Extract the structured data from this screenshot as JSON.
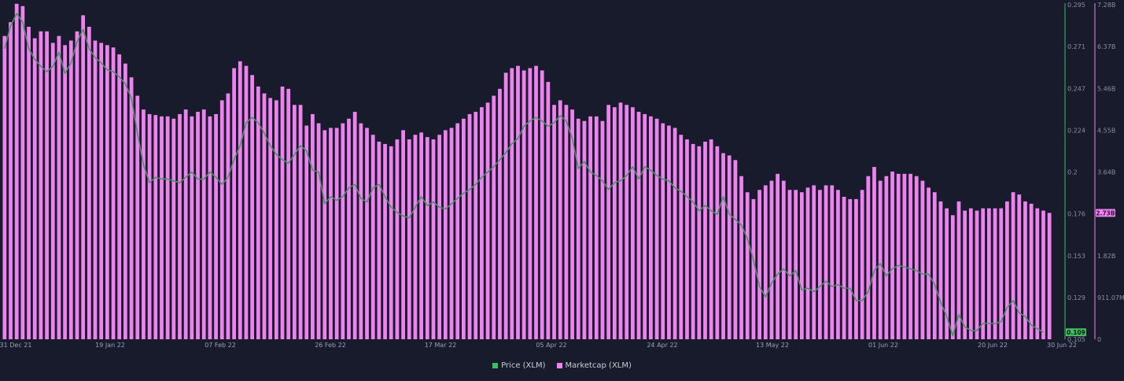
{
  "colors": {
    "background": "#171b2b",
    "price": "#3fbe5f",
    "marketcap": "#ee82ee",
    "price_line": "#4f8f6a"
  },
  "legend": {
    "price_label": "Price (XLM)",
    "marketcap_label": "Marketcap (XLM)"
  },
  "price_axis": {
    "ticks": [
      "0.295",
      "0.271",
      "0.247",
      "0.224",
      "0.2",
      "0.176",
      "0.153",
      "0.129",
      "0.105"
    ],
    "current_label": "0.109"
  },
  "marketcap_axis": {
    "ticks": [
      "7.28B",
      "6.37B",
      "5.46B",
      "4.55B",
      "3.64B",
      "2.73B",
      "1.82B",
      "911.07M",
      "0"
    ],
    "current_label": "2.73B"
  },
  "chart_data": {
    "type": "bar",
    "x_range": [
      "31 Dec 21",
      "30 Jun 22"
    ],
    "x_ticks": [
      "31 Dec 21",
      "19 Jan 22",
      "07 Feb 22",
      "26 Feb 22",
      "17 Mar 22",
      "05 Apr 22",
      "24 Apr 22",
      "13 May 22",
      "01 Jun 22",
      "20 Jun 22",
      "30 Jun 22"
    ],
    "price_ylim": [
      0.105,
      0.295
    ],
    "marketcap_ylim": [
      0,
      7280000000
    ],
    "grid": false,
    "legend_position": "bottom-center",
    "series": [
      {
        "name": "Marketcap (XLM)",
        "type": "bar",
        "values": [
          6.6,
          6.9,
          7.3,
          7.25,
          6.8,
          6.55,
          6.7,
          6.7,
          6.45,
          6.6,
          6.4,
          6.5,
          6.7,
          7.05,
          6.8,
          6.5,
          6.45,
          6.4,
          6.35,
          6.2,
          6.0,
          5.7,
          5.3,
          5.0,
          4.9,
          4.88,
          4.85,
          4.85,
          4.8,
          4.9,
          5.0,
          4.85,
          4.95,
          5.0,
          4.85,
          4.9,
          5.2,
          5.35,
          5.9,
          6.05,
          5.95,
          5.75,
          5.5,
          5.35,
          5.25,
          5.2,
          5.5,
          5.45,
          5.1,
          5.1,
          4.65,
          4.9,
          4.7,
          4.55,
          4.6,
          4.6,
          4.7,
          4.8,
          4.95,
          4.7,
          4.6,
          4.45,
          4.3,
          4.25,
          4.2,
          4.35,
          4.55,
          4.35,
          4.45,
          4.5,
          4.4,
          4.35,
          4.45,
          4.55,
          4.6,
          4.7,
          4.8,
          4.9,
          4.95,
          5.05,
          5.15,
          5.3,
          5.45,
          5.8,
          5.9,
          5.95,
          5.85,
          5.9,
          5.95,
          5.85,
          5.6,
          5.1,
          5.2,
          5.1,
          5.0,
          4.8,
          4.75,
          4.85,
          4.85,
          4.75,
          5.1,
          5.05,
          5.15,
          5.1,
          5.05,
          4.95,
          4.9,
          4.85,
          4.8,
          4.7,
          4.65,
          4.6,
          4.45,
          4.35,
          4.25,
          4.2,
          4.3,
          4.35,
          4.2,
          4.05,
          4.0,
          3.9,
          3.55,
          3.2,
          3.05,
          3.25,
          3.35,
          3.45,
          3.6,
          3.45,
          3.25,
          3.25,
          3.2,
          3.3,
          3.35,
          3.25,
          3.35,
          3.35,
          3.25,
          3.1,
          3.05,
          3.05,
          3.25,
          3.55,
          3.75,
          3.45,
          3.55,
          3.65,
          3.6,
          3.6,
          3.6,
          3.55,
          3.45,
          3.3,
          3.2,
          3.0,
          2.85,
          2.7,
          3.0,
          2.8,
          2.85,
          2.8,
          2.85,
          2.85,
          2.85,
          2.85,
          3.0,
          3.2,
          3.15,
          3.0,
          2.95,
          2.85,
          2.8,
          2.75
        ]
      },
      {
        "name": "Price (XLM)",
        "type": "line",
        "values": [
          0.27,
          0.283,
          0.29,
          0.285,
          0.27,
          0.264,
          0.26,
          0.257,
          0.26,
          0.268,
          0.256,
          0.262,
          0.274,
          0.281,
          0.27,
          0.265,
          0.262,
          0.258,
          0.257,
          0.254,
          0.25,
          0.242,
          0.222,
          0.204,
          0.194,
          0.197,
          0.196,
          0.196,
          0.195,
          0.194,
          0.197,
          0.2,
          0.196,
          0.196,
          0.2,
          0.197,
          0.193,
          0.197,
          0.207,
          0.215,
          0.228,
          0.231,
          0.228,
          0.222,
          0.215,
          0.21,
          0.207,
          0.205,
          0.21,
          0.215,
          0.212,
          0.201,
          0.2,
          0.182,
          0.186,
          0.184,
          0.186,
          0.191,
          0.193,
          0.185,
          0.183,
          0.191,
          0.193,
          0.186,
          0.18,
          0.177,
          0.175,
          0.174,
          0.18,
          0.186,
          0.181,
          0.183,
          0.18,
          0.179,
          0.182,
          0.185,
          0.188,
          0.19,
          0.193,
          0.197,
          0.2,
          0.203,
          0.207,
          0.211,
          0.216,
          0.219,
          0.226,
          0.229,
          0.231,
          0.229,
          0.226,
          0.228,
          0.232,
          0.229,
          0.219,
          0.202,
          0.206,
          0.2,
          0.198,
          0.195,
          0.19,
          0.194,
          0.195,
          0.198,
          0.203,
          0.196,
          0.203,
          0.201,
          0.198,
          0.196,
          0.195,
          0.191,
          0.189,
          0.186,
          0.183,
          0.178,
          0.181,
          0.178,
          0.176,
          0.186,
          0.176,
          0.173,
          0.17,
          0.162,
          0.15,
          0.135,
          0.129,
          0.137,
          0.142,
          0.145,
          0.141,
          0.144,
          0.133,
          0.134,
          0.132,
          0.135,
          0.138,
          0.135,
          0.136,
          0.134,
          0.134,
          0.127,
          0.127,
          0.132,
          0.144,
          0.148,
          0.141,
          0.145,
          0.147,
          0.146,
          0.145,
          0.144,
          0.142,
          0.142,
          0.136,
          0.126,
          0.118,
          0.107,
          0.119,
          0.112,
          0.11,
          0.11,
          0.114,
          0.114,
          0.114,
          0.115,
          0.123,
          0.127,
          0.12,
          0.118,
          0.113,
          0.111,
          0.109
        ]
      }
    ]
  }
}
